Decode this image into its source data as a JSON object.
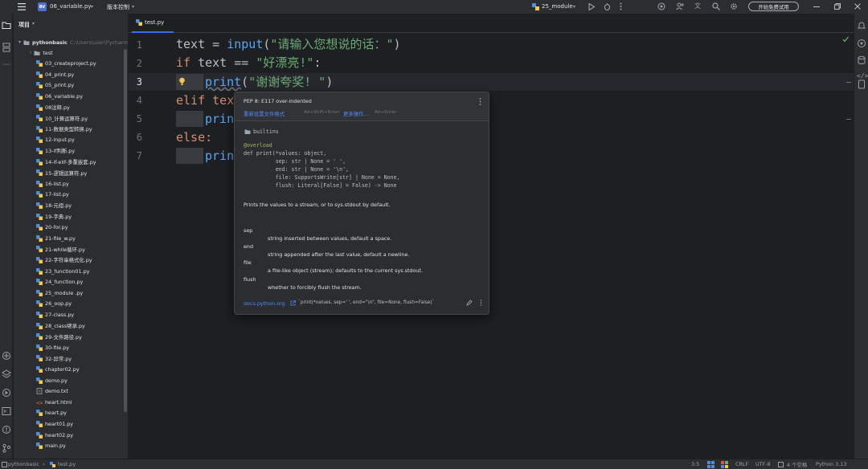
{
  "titlebar": {
    "menu_icon": "hamburger-icon",
    "project_badge": "BV",
    "project_name": "06_variable.py",
    "vcs_label": "版本控制",
    "run_config": "25_module",
    "upgrade_button": "开始免费试用",
    "colors": {
      "badge": "#4c6fcf",
      "accent": "#3574f0"
    }
  },
  "project_panel": {
    "title": "项目",
    "root_name": "pythonbasic",
    "root_path": "C:\\Users\\user\\PycharmProjects\\pythonbasic",
    "files": [
      "test",
      "03_createproject.py",
      "04_print.py",
      "05_print.py",
      "06_variable.py",
      "08注释.py",
      "10_计算运算符.py",
      "11-数据类型转换.py",
      "12-input.py",
      "13-if判断.py",
      "14-if-elif-多重嵌套.py",
      "15-逻辑运算符.py",
      "16-list.py",
      "17-list.py",
      "18-元组.py",
      "19-字典.py",
      "20-for.py",
      "21-file_w.py",
      "21-while循环.py",
      "22-字符串格式化.py",
      "23_function01.py",
      "24_function.py",
      "25_module .py",
      "26_oop.py",
      "27-class.py",
      "28_class继承.py",
      "29-文件路径.py",
      "30-file.py",
      "32-异常.py",
      "chapter02.py",
      "demo.py",
      "demo.txt",
      "heart.html",
      "heart.py",
      "heart01.py",
      "heart02.py",
      "main.py"
    ]
  },
  "editor": {
    "tab_label": "test.py",
    "line_numbers": [
      "1",
      "2",
      "3",
      "4",
      "5",
      "6",
      "7"
    ],
    "lines": {
      "l1": {
        "a": "text = ",
        "b": "input",
        "c": "(",
        "d": "\"请输入您想说的话：\"",
        "e": ")"
      },
      "l2": {
        "a": "if",
        "b": " text == ",
        "c": "\"好漂亮!\"",
        "d": ":"
      },
      "l3": {
        "a": "print",
        "b": "(",
        "c": "\"谢谢夸奖! \"",
        "d": ")"
      },
      "l4": "elif tex",
      "l5": "prin",
      "l6": "else:",
      "l7": "prin"
    }
  },
  "popup": {
    "inspection": "PEP 8: E117 over-indented",
    "action1": "重新设置文件格式",
    "shortcut1": "Alt+Shift+Enter",
    "action2": "更多操作...",
    "shortcut2": "Alt+Enter",
    "module": "builtins",
    "decorator": "@overload",
    "signature": [
      "def print(*values: object,",
      "          sep: str | None = ' ',",
      "          end: str | None = '\\n',",
      "          file: SupportsWrite[str] | None = None,",
      "          flush: Literal[False] = False) -> None"
    ],
    "summary": "Prints the values to a stream, or to sys.stdout by default.",
    "params": [
      {
        "name": "sep",
        "desc": "string inserted between values, default a space."
      },
      {
        "name": "end",
        "desc": "string appended after the last value, default a newline."
      },
      {
        "name": "file",
        "desc": "a file-like object (stream); defaults to the current sys.stdout."
      },
      {
        "name": "flush",
        "desc": "whether to forcibly flush the stream."
      }
    ],
    "footer_link": "docs.python.org",
    "footer_code": "`print(*values, sep=' ', end=\"\\n\", file=None, flush=False)`"
  },
  "statusbar": {
    "crumb1": "pythonbasic",
    "crumb2": "test.py",
    "position": "3:5",
    "line_ending": "CRLF",
    "encoding": "UTF-8",
    "indent": "4 个空格",
    "interpreter": "Python 3.13"
  }
}
